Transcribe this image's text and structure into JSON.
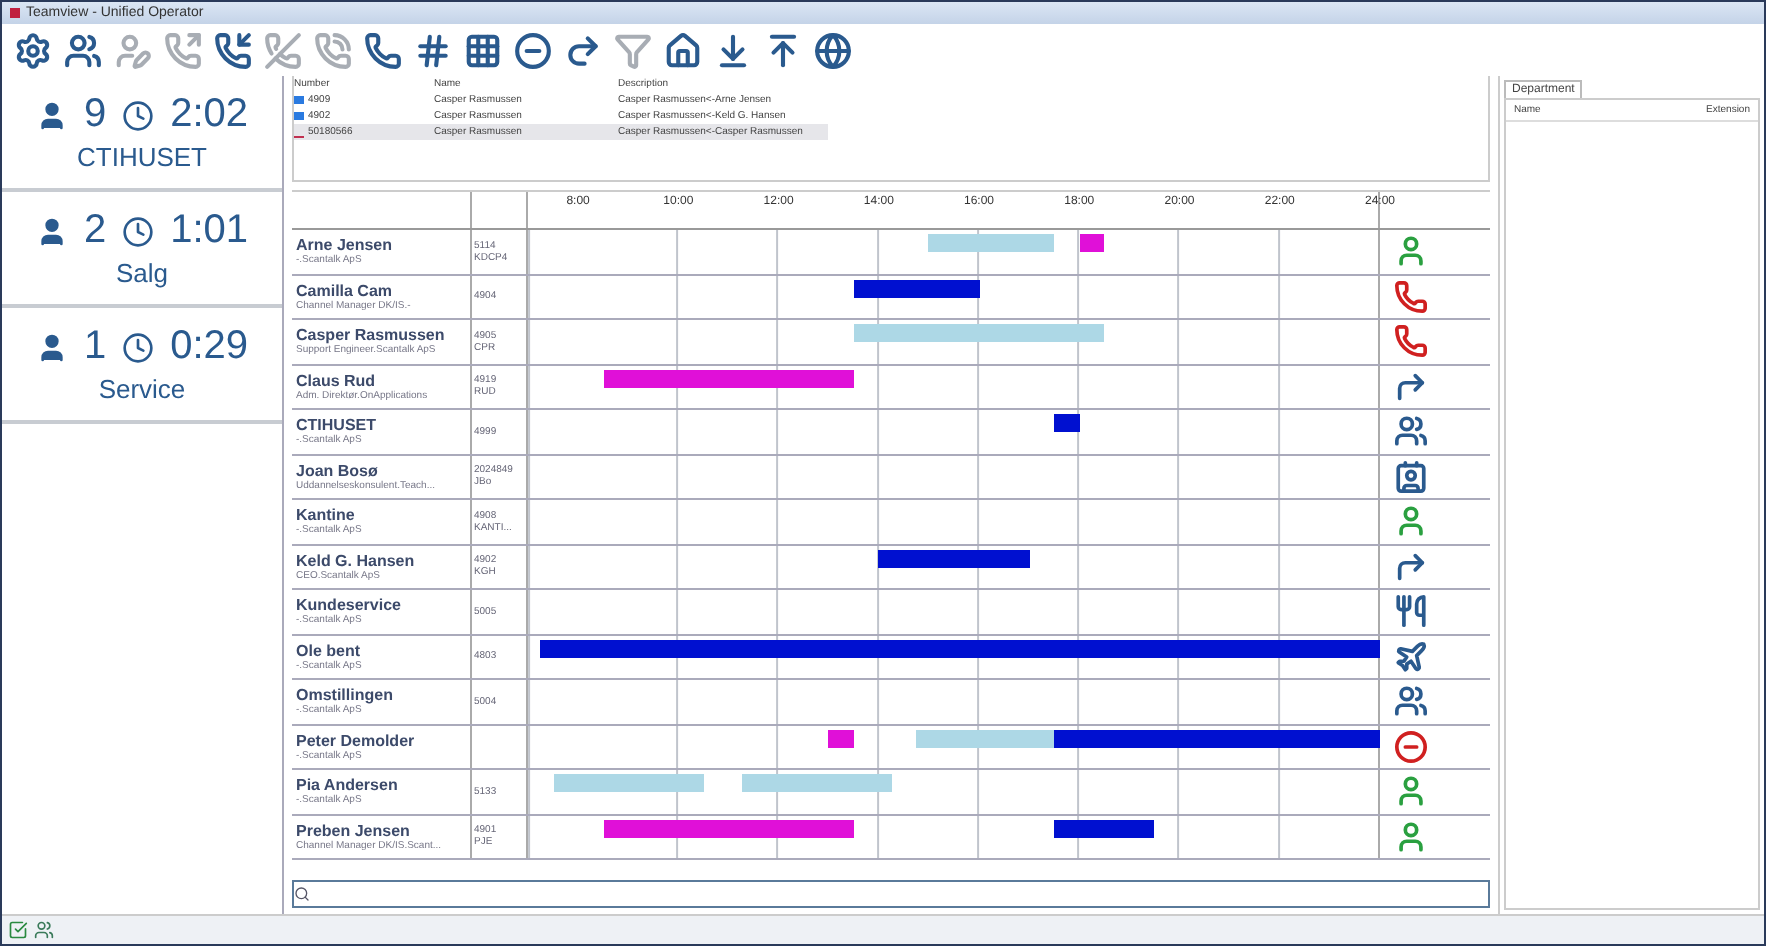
{
  "window": {
    "title": "Teamview - Unified Operator"
  },
  "toolbar": [
    {
      "disabled": false
    },
    {
      "disabled": false
    },
    {
      "disabled": true
    },
    {
      "disabled": true
    },
    {
      "disabled": false
    },
    {
      "disabled": true
    },
    {
      "disabled": true
    },
    {
      "disabled": false
    },
    {
      "disabled": false
    },
    {
      "disabled": false
    },
    {
      "disabled": false
    },
    {
      "disabled": false
    },
    {
      "disabled": true
    },
    {
      "disabled": false
    },
    {
      "disabled": false
    },
    {
      "disabled": false
    },
    {
      "disabled": false
    }
  ],
  "queues": [
    {
      "agents": "9",
      "wait": "2:02",
      "name": "CTIHUSET"
    },
    {
      "agents": "2",
      "wait": "1:01",
      "name": "Salg"
    },
    {
      "agents": "1",
      "wait": "0:29",
      "name": "Service"
    }
  ],
  "calls": {
    "columns": [
      "Number",
      "Name",
      "Description"
    ],
    "rows": [
      {
        "kind": "line",
        "selected": false,
        "cells": [
          "4909",
          "Casper Rasmussen",
          "Casper Rasmussen<-Arne Jensen"
        ]
      },
      {
        "kind": "line",
        "selected": false,
        "cells": [
          "4902",
          "Casper Rasmussen",
          "Casper Rasmussen<-Keld G. Hansen"
        ]
      },
      {
        "kind": "external",
        "selected": true,
        "cells": [
          "50180566",
          "Casper Rasmussen",
          "Casper Rasmussen<-Casper Rasmussen"
        ]
      }
    ]
  },
  "timeline": {
    "hours": [
      "8:00",
      "10:00",
      "12:00",
      "14:00",
      "16:00",
      "18:00",
      "20:00",
      "22:00",
      "24:00"
    ],
    "rows": [
      {
        "name": "Arne Jensen",
        "title": "-.Scantalk ApS",
        "extension": "5114",
        "initials": "KDCP4",
        "kind": "available",
        "bars": [
          {
            "color": "#add8e6"
          },
          {
            "color": "#e010d8"
          }
        ]
      },
      {
        "name": "Camilla Cam",
        "title": "Channel Manager DK/IS.-",
        "extension": "4904",
        "kind": "phone",
        "bars": [
          {
            "color": "#0010d0"
          }
        ]
      },
      {
        "name": "Casper Rasmussen",
        "title": "Support Engineer.Scantalk ApS",
        "extension": "4905",
        "initials": "CPR",
        "kind": "phone",
        "bars": [
          {
            "color": "#add8e6"
          }
        ]
      },
      {
        "name": "Claus Rud",
        "title": "Adm. Direktør.OnApplications",
        "extension": "4919",
        "initials": "RUD",
        "kind": "forward",
        "bars": [
          {
            "color": "#e010d8"
          }
        ]
      },
      {
        "name": "CTIHUSET",
        "title": "-.Scantalk ApS",
        "extension": "4999",
        "kind": "group",
        "bars": [
          {
            "color": "#0010d0"
          }
        ]
      },
      {
        "name": "Joan Bosø",
        "title": "Uddannelseskonsulent.Teach...",
        "extension": "2024849",
        "initials": "JBo",
        "kind": "card"
      },
      {
        "name": "Kantine",
        "title": "-.Scantalk ApS",
        "extension": "4908",
        "initials": "KANTI...",
        "kind": "available"
      },
      {
        "name": "Keld G. Hansen",
        "title": "CEO.Scantalk ApS",
        "extension": "4902",
        "initials": "KGH",
        "kind": "forward",
        "bars": [
          {
            "color": "#0010d0"
          }
        ]
      },
      {
        "name": "Kundeservice",
        "title": "-.Scantalk ApS",
        "extension": "5005",
        "kind": "lunch"
      },
      {
        "name": "Ole bent",
        "title": "-.Scantalk ApS",
        "extension": "4803",
        "kind": "travel",
        "bars": [
          {
            "color": "#0010d0"
          }
        ]
      },
      {
        "name": "Omstillingen",
        "title": "-.Scantalk ApS",
        "extension": "5004",
        "kind": "group"
      },
      {
        "name": "Peter Demolder",
        "title": "-.Scantalk ApS",
        "kind": "busy",
        "bars": [
          {
            "color": "#e010d8"
          },
          {
            "color": "#add8e6"
          },
          {
            "color": "#0010d0"
          }
        ]
      },
      {
        "name": "Pia Andersen",
        "title": "-.Scantalk ApS",
        "extension": "5133",
        "kind": "available",
        "bars": [
          {
            "color": "#add8e6"
          },
          {
            "color": "#add8e6"
          }
        ]
      },
      {
        "name": "Preben Jensen",
        "title": "Channel Manager DK/IS.Scant...",
        "extension": "4901",
        "initials": "PJE",
        "kind": "available",
        "bars": [
          {
            "color": "#e010d8"
          },
          {
            "color": "#0010d0"
          }
        ]
      }
    ]
  },
  "department": {
    "tab": "Department",
    "columns": [
      "Name",
      "Extension"
    ]
  }
}
